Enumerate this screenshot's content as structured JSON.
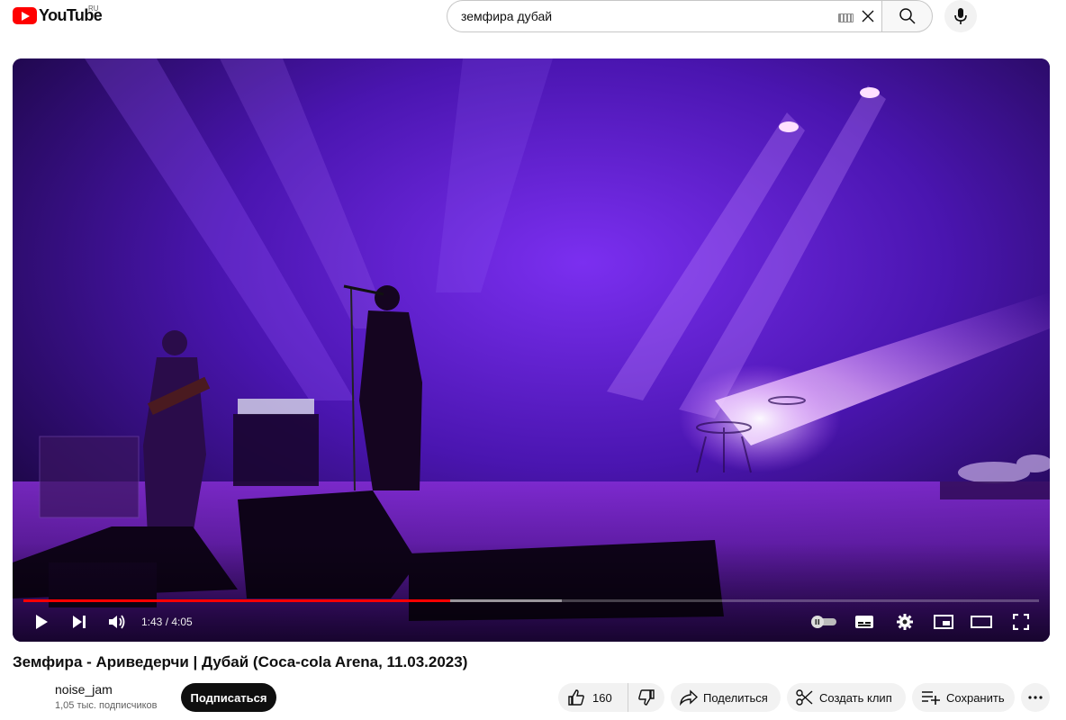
{
  "header": {
    "logo_text": "YouTube",
    "region": "RU",
    "search_value": "земфира дубай"
  },
  "player": {
    "time_current": "1:43",
    "time_total": "4:05",
    "time_display": "1:43 / 4:05",
    "progress_fraction": 0.42,
    "buffered_fraction": 0.53
  },
  "video": {
    "title": "Земфира - Ариведерчи | Дубай (Coca-cola Arena, 11.03.2023)",
    "channel_name": "noise_jam",
    "subscriber_count": "1,05 тыс. подписчиков",
    "subscribe_label": "Подписаться"
  },
  "actions": {
    "like_count": "160",
    "share_label": "Поделиться",
    "clip_label": "Создать клип",
    "save_label": "Сохранить"
  },
  "colors": {
    "brand_red": "#ff0000",
    "stage_purple": "#6a1fd0"
  }
}
